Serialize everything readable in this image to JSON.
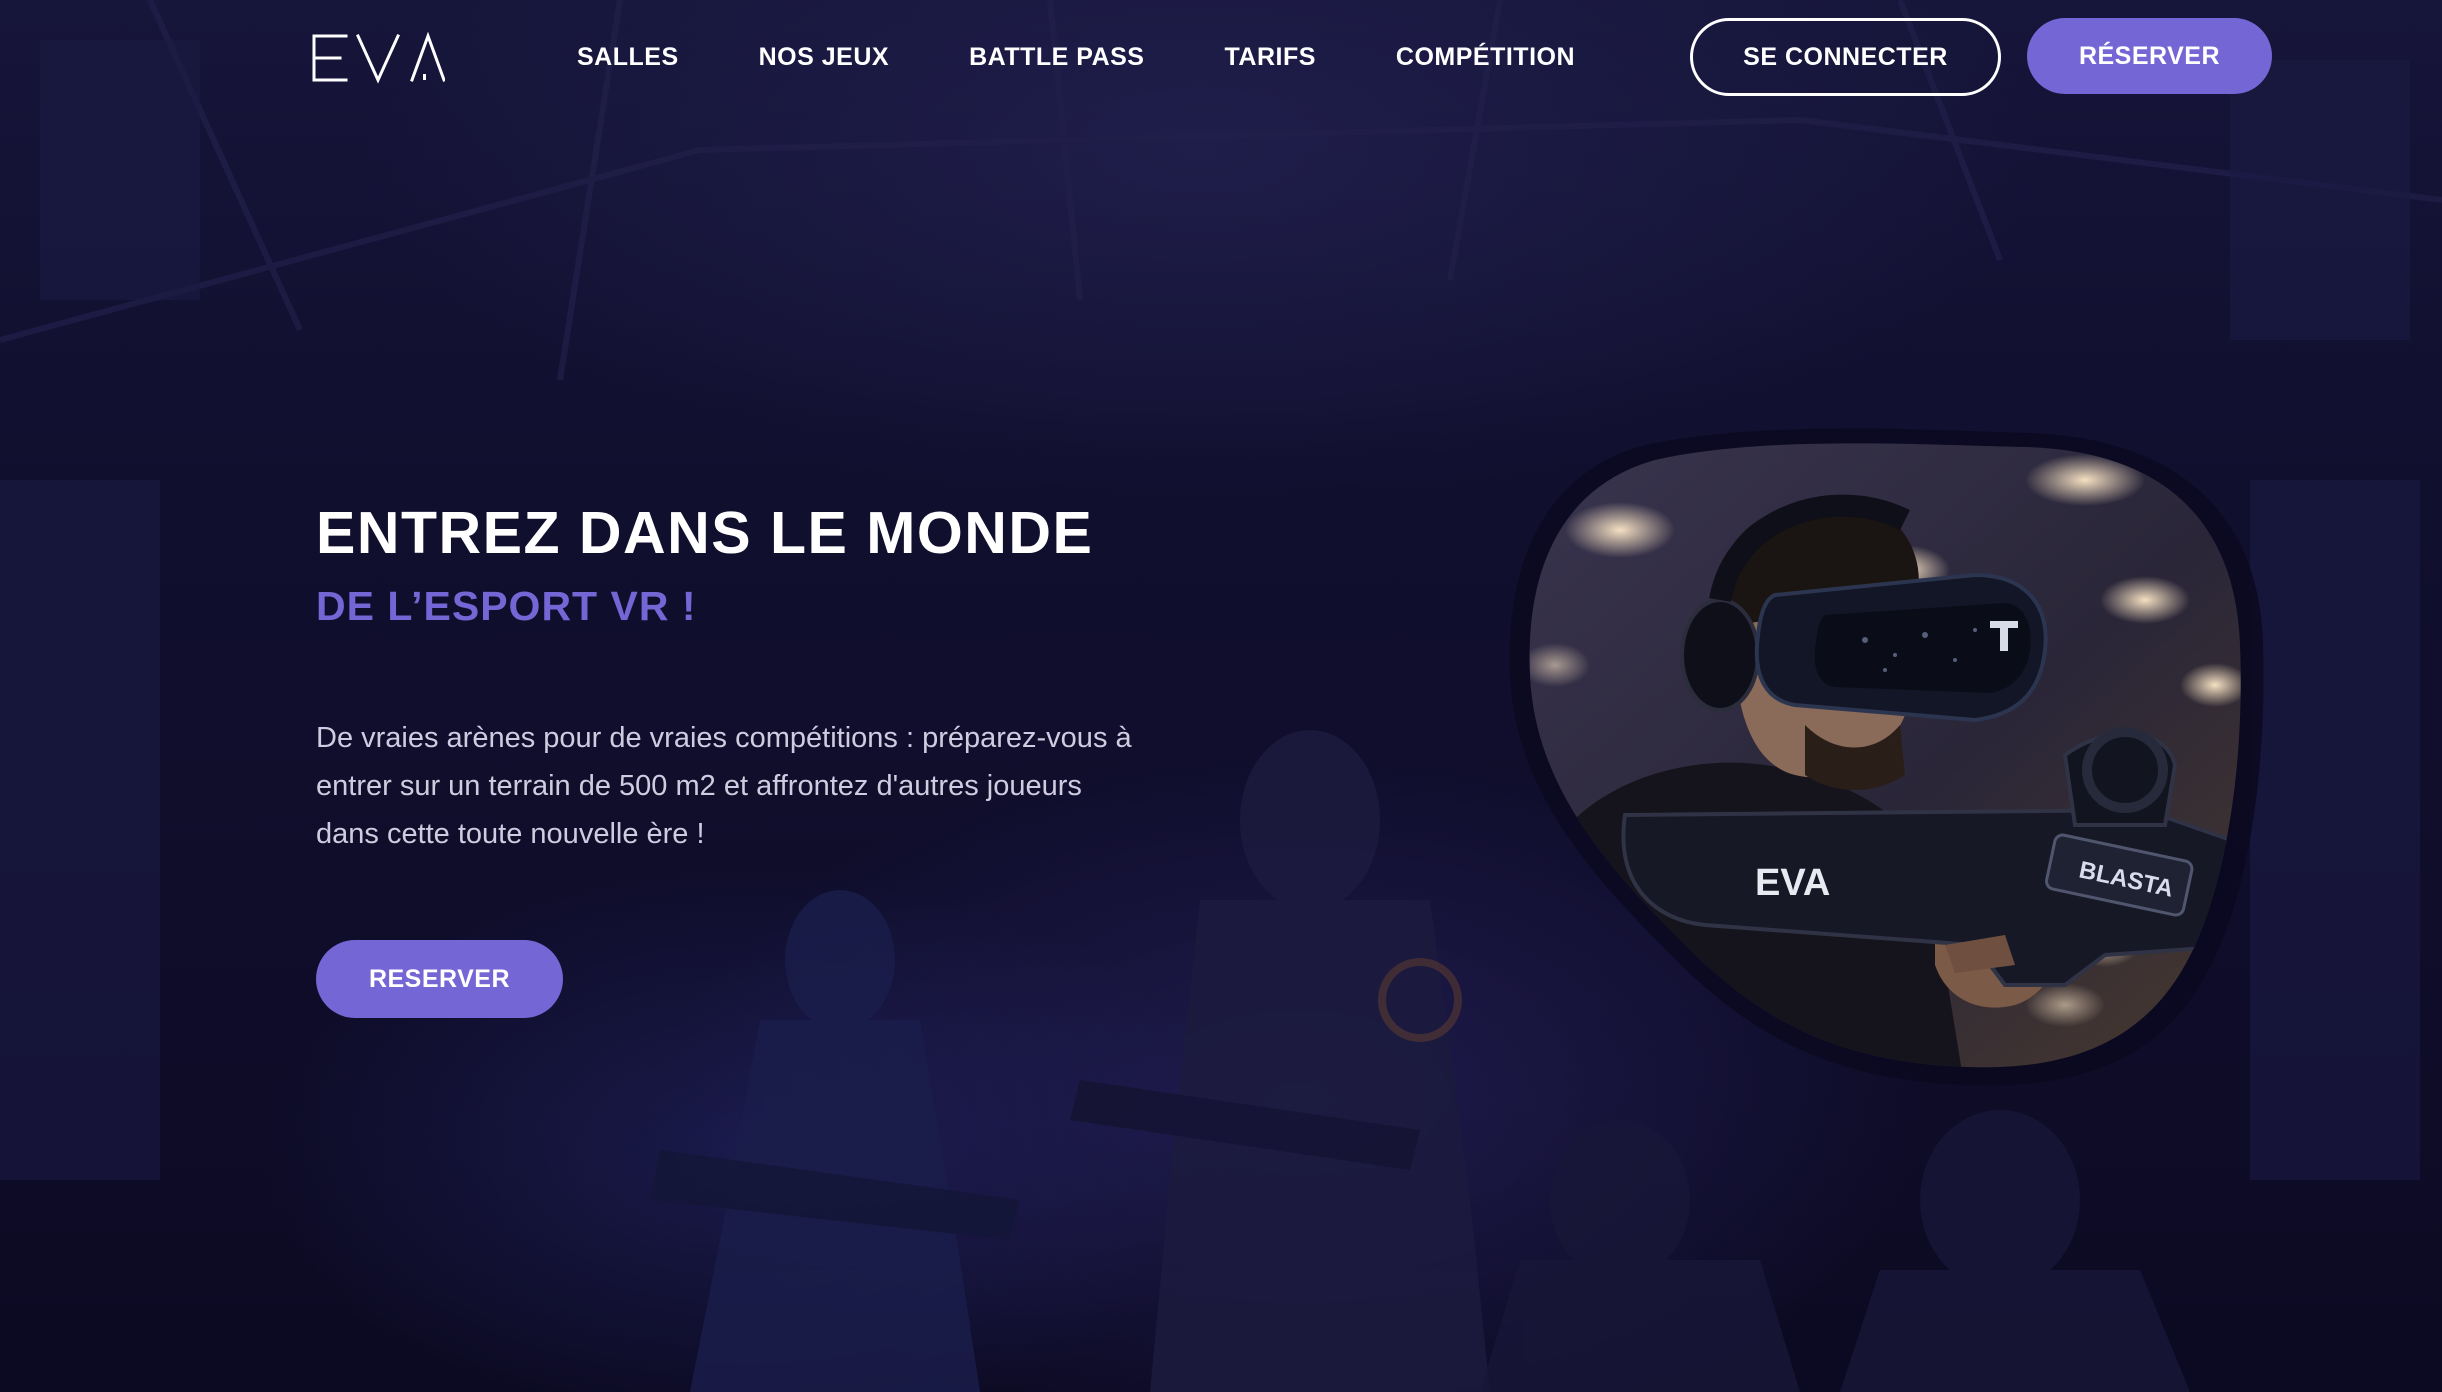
{
  "header": {
    "logo_text": "EVA",
    "nav": [
      {
        "label": "SALLES"
      },
      {
        "label": "NOS JEUX"
      },
      {
        "label": "BATTLE PASS"
      },
      {
        "label": "TARIFS"
      },
      {
        "label": "COMPÉTITION"
      }
    ],
    "connect_label": "SE CONNECTER",
    "reserve_label": "RÉSERVER"
  },
  "hero": {
    "title": "ENTREZ DANS LE MONDE",
    "subtitle": "DE L’ESPORT VR !",
    "description": "De vraies arènes pour de vraies compétitions : préparez-vous à entrer sur un terrain de 500 m2 et affrontez d'autres joueurs dans cette toute nouvelle ère !",
    "cta_label": "RESERVER",
    "image_texts": {
      "brand": "EVA",
      "blaster": "BLASTA"
    }
  },
  "colors": {
    "accent": "#7466d4",
    "background": "#0f0d2a",
    "text": "#ffffff",
    "body_text": "#cfcbe0"
  }
}
